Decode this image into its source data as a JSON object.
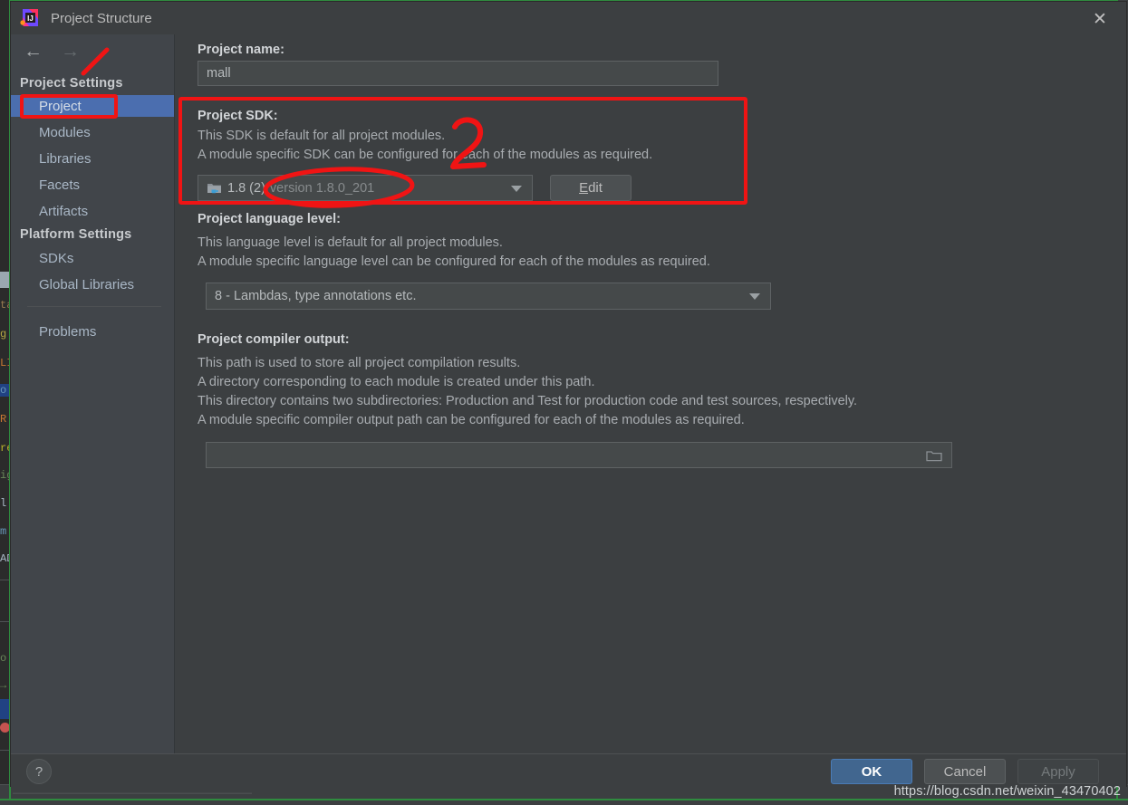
{
  "window": {
    "title": "Project Structure",
    "app_icon": "intellij-idea-icon",
    "close_icon": "close-icon"
  },
  "nav": {
    "back_icon": "arrow-left-icon",
    "forward_icon": "arrow-right-icon"
  },
  "sidebar": {
    "groups": [
      {
        "header": "Project Settings",
        "items": [
          {
            "label": "Project",
            "selected": true
          },
          {
            "label": "Modules",
            "selected": false
          },
          {
            "label": "Libraries",
            "selected": false
          },
          {
            "label": "Facets",
            "selected": false
          },
          {
            "label": "Artifacts",
            "selected": false
          }
        ]
      },
      {
        "header": "Platform Settings",
        "items": [
          {
            "label": "SDKs",
            "selected": false
          },
          {
            "label": "Global Libraries",
            "selected": false
          }
        ]
      }
    ],
    "extra_items": [
      {
        "label": "Problems",
        "selected": false
      }
    ]
  },
  "main": {
    "project_name": {
      "label": "Project name:",
      "value": "mall"
    },
    "project_sdk": {
      "label": "Project SDK:",
      "desc_line_1": "This SDK is default for all project modules.",
      "desc_line_2": "A module specific SDK can be configured for each of the modules as required.",
      "selected_sdk": "1.8 (2)",
      "selected_sdk_version": "version 1.8.0_201",
      "sdk_icon": "java-sdk-folder-icon",
      "dropdown_icon": "chevron-down-icon",
      "edit_button": "Edit",
      "edit_button_mnemonic": "E"
    },
    "language_level": {
      "label": "Project language level:",
      "desc_line_1": "This language level is default for all project modules.",
      "desc_line_2": "A module specific language level can be configured for each of the modules as required.",
      "value": "8 - Lambdas, type annotations etc.",
      "dropdown_icon": "chevron-down-icon"
    },
    "compiler_output": {
      "label": "Project compiler output:",
      "desc_line_1": "This path is used to store all project compilation results.",
      "desc_line_2": "A directory corresponding to each module is created under this path.",
      "desc_line_3": "This directory contains two subdirectories: Production and Test for production code and test sources, respectively.",
      "desc_line_4": "A module specific compiler output path can be configured for each of the modules as required.",
      "value": "",
      "browse_icon": "folder-browse-icon"
    }
  },
  "footer": {
    "help_label": "?",
    "help_icon": "help-icon",
    "ok": "OK",
    "cancel": "Cancel",
    "apply": "Apply",
    "apply_disabled": true
  },
  "annotations": {
    "marker_2": "2",
    "highlight_color": "#f01414",
    "sidebar_project_box": "red box around Project nav item",
    "sdk_section_box": "red box around Project SDK section",
    "sdk_version_ellipse": "red ellipse around SDK version text",
    "tick_mark": "red diagonal tick near Project Settings"
  },
  "watermark": {
    "url": "https://blog.csdn.net/weixin_43470402"
  },
  "background": {
    "code_fragments": [
      "ta",
      "g",
      "LI",
      "o",
      "R",
      "re",
      "ig",
      "l.",
      "m",
      "AD"
    ],
    "status_text": "————————————————————————"
  },
  "colors": {
    "dialog_bg": "#3c3f41",
    "sidebar_bg": "#41454a",
    "selection_blue": "#4b6eaf",
    "primary_button": "#41668f",
    "field_bg": "#45494a",
    "text": "#a9b7c6",
    "capture_border": "#2f8b3f"
  }
}
